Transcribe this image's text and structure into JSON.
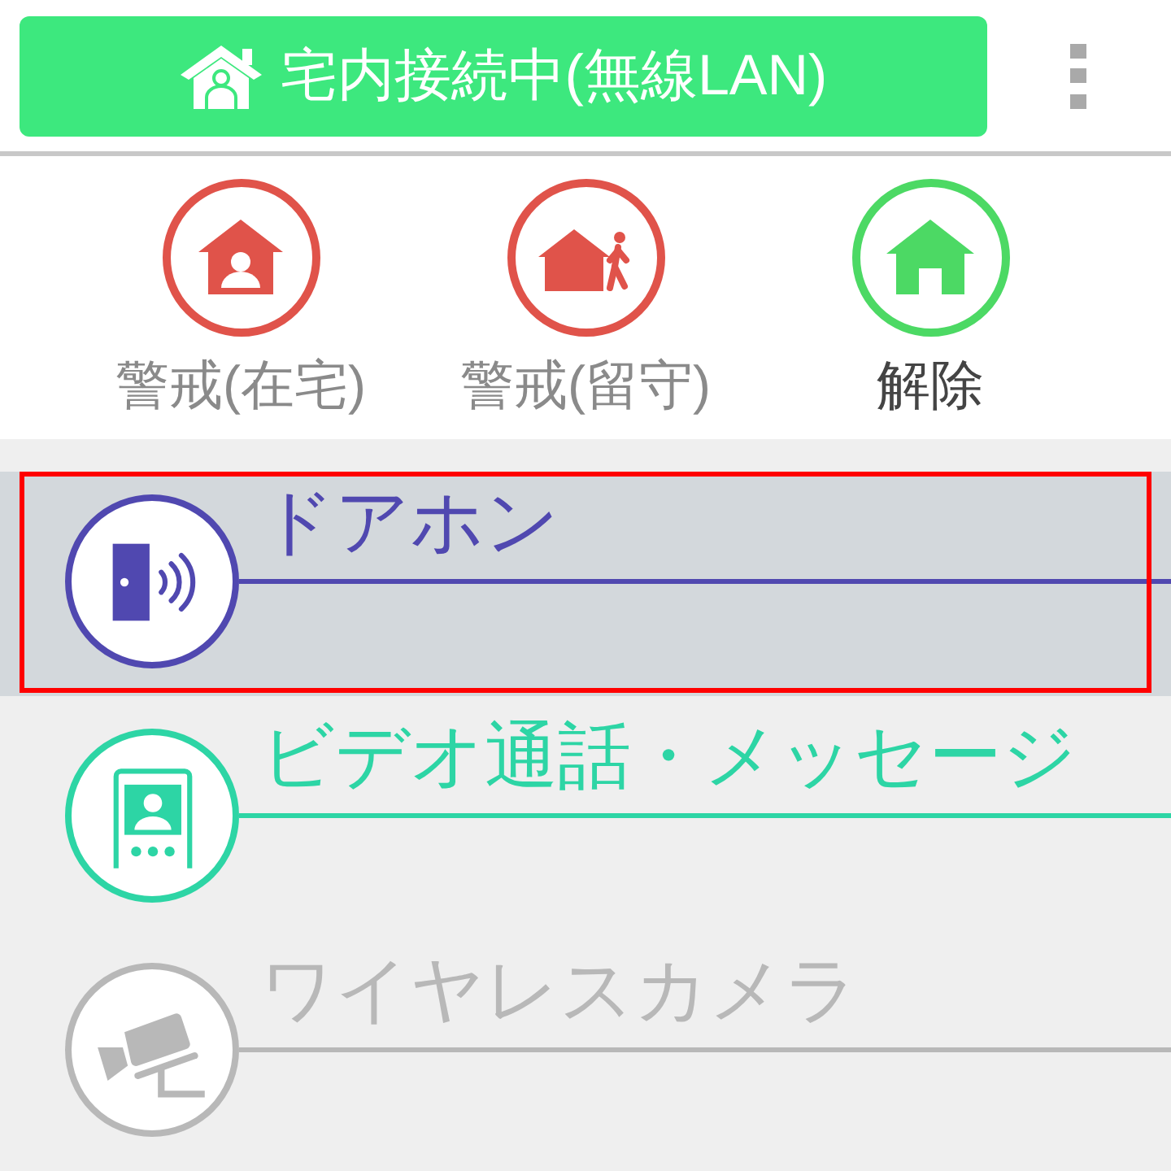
{
  "header": {
    "status": {
      "label": "宅内接続中(無線LAN)"
    }
  },
  "modes": [
    {
      "kind": "home",
      "label": "警戒(在宅)",
      "color": "#e0534a",
      "selected": false
    },
    {
      "kind": "away",
      "label": "警戒(留守)",
      "color": "#e0534a",
      "selected": false
    },
    {
      "kind": "off",
      "label": "解除",
      "color": "#4cd964",
      "selected": true
    }
  ],
  "items": [
    {
      "kind": "doorphone",
      "title": "ドアホン",
      "color": "#5048b0",
      "selected": true
    },
    {
      "kind": "video",
      "title": "ビデオ通話・メッセージ",
      "color": "#2dd5a5",
      "selected": false
    },
    {
      "kind": "camera",
      "title": "ワイヤレスカメラ",
      "color": "#b8b8b8",
      "selected": false
    }
  ]
}
